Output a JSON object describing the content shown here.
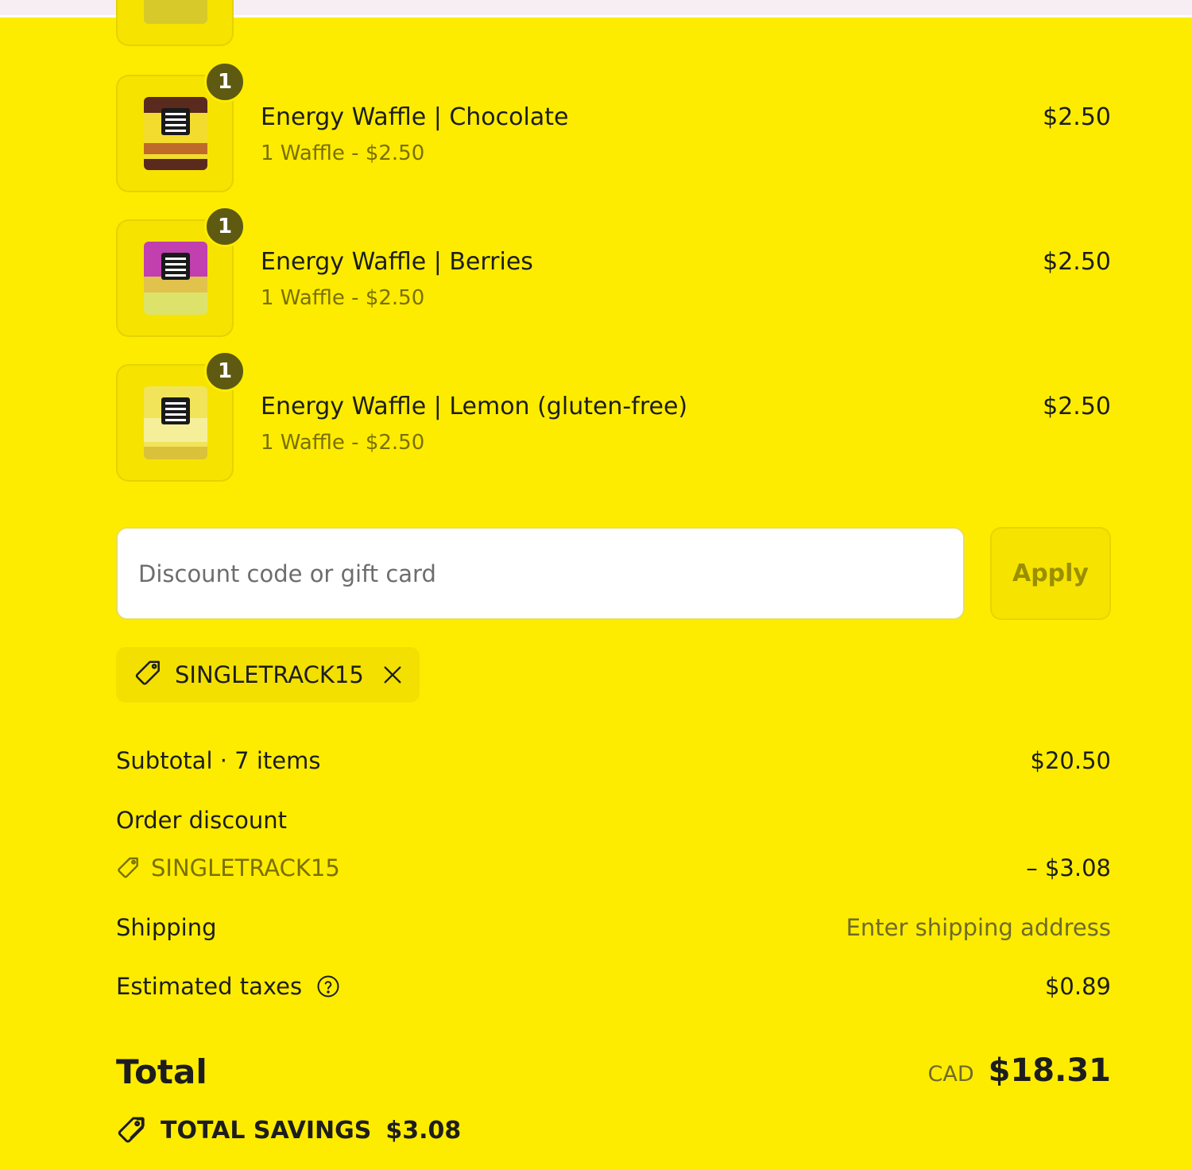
{
  "items": [
    {
      "quantity": "1",
      "title": "Energy Waffle | Chocolate",
      "variant": "1 Waffle - $2.50",
      "price": "$2.50"
    },
    {
      "quantity": "1",
      "title": "Energy Waffle | Berries",
      "variant": "1 Waffle - $2.50",
      "price": "$2.50"
    },
    {
      "quantity": "1",
      "title": "Energy Waffle | Lemon (gluten-free)",
      "variant": "1 Waffle - $2.50",
      "price": "$2.50"
    }
  ],
  "discount": {
    "placeholder": "Discount code or gift card",
    "apply_label": "Apply",
    "applied_code": "SINGLETRACK15"
  },
  "summary": {
    "subtotal_label": "Subtotal · 7 items",
    "subtotal_value": "$20.50",
    "order_discount_label": "Order discount",
    "order_discount_code": "SINGLETRACK15",
    "order_discount_value": "– $3.08",
    "shipping_label": "Shipping",
    "shipping_value": "Enter shipping address",
    "taxes_label": "Estimated taxes",
    "taxes_value": "$0.89",
    "total_label": "Total",
    "currency": "CAD",
    "total_value": "$18.31",
    "savings_label": "TOTAL SAVINGS",
    "savings_value": "$3.08"
  },
  "icons": {
    "tag": "tag-icon",
    "close": "close-icon",
    "help": "question-circle-icon"
  },
  "colors": {
    "background": "#FDEC00",
    "badge": "#5e5a12",
    "muted_text": "#7a7000"
  }
}
